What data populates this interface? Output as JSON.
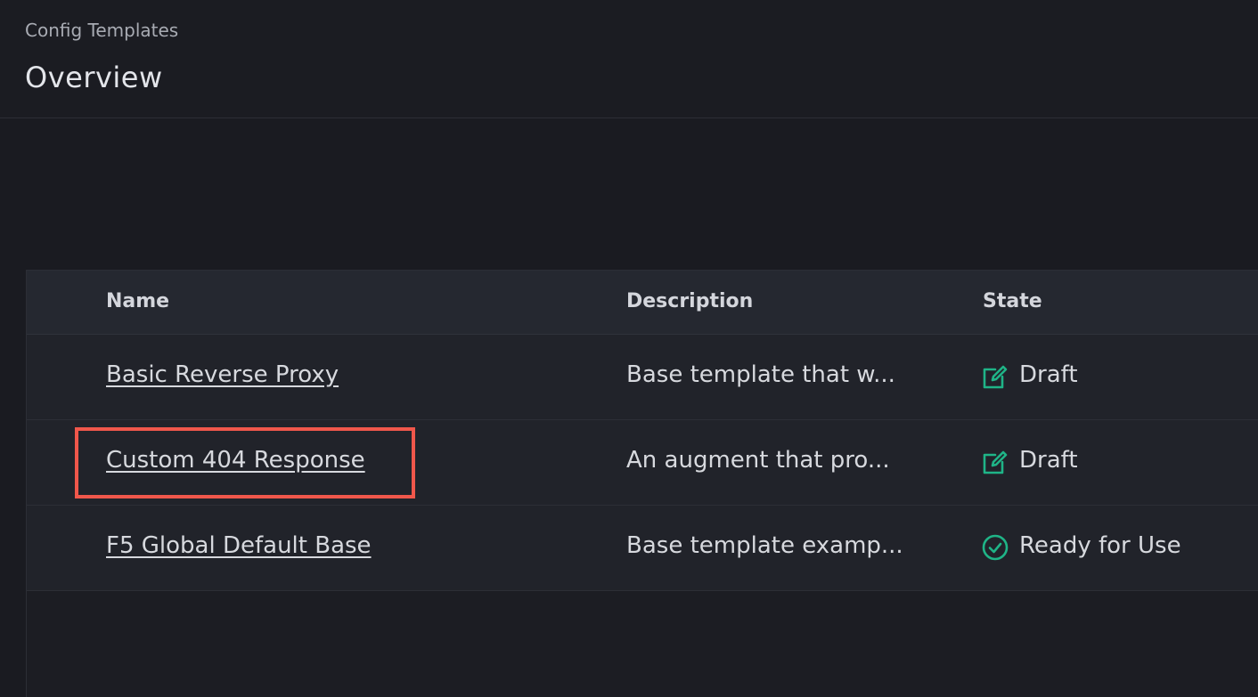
{
  "header": {
    "breadcrumb": "Config Templates",
    "title": "Overview"
  },
  "table": {
    "columns": {
      "name": "Name",
      "description": "Description",
      "state": "State"
    },
    "rows": [
      {
        "name": "Basic Reverse Proxy",
        "description": "Base template that w...",
        "state": "Draft",
        "state_icon": "edit-icon"
      },
      {
        "name": "Custom 404 Response",
        "description": "An augment that pro...",
        "state": "Draft",
        "state_icon": "edit-icon"
      },
      {
        "name": "F5 Global Default Base",
        "description": "Base template examp...",
        "state": "Ready for Use",
        "state_icon": "check-circle-icon"
      }
    ]
  },
  "colors": {
    "accent_green": "#1fb487",
    "highlight_red": "#f0574b"
  }
}
